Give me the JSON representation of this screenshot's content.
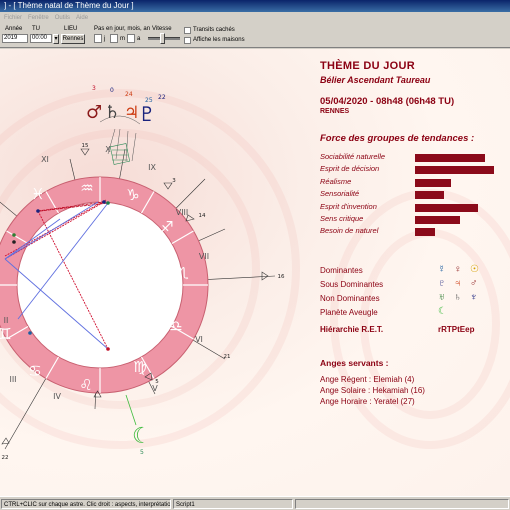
{
  "window": {
    "title": "] - [ Thème natal de Thème du Jour ]"
  },
  "menu": [
    "Fichier",
    "Fenêtre",
    "Outils",
    "Aide"
  ],
  "toolbar": {
    "year_label": "Année",
    "year_value": "2019",
    "tu_label": "TU",
    "tu_value": "00:00",
    "lieu_label": "LIEU",
    "lieu_button": "Rennes",
    "step_label": "Pas en jour, mois, an",
    "step_j": "j",
    "step_m": "m",
    "step_a": "a",
    "vitesse_label": "Vitesse",
    "transits_label": "Transits cachés",
    "maisons_label": "Affiche les maisons"
  },
  "panel": {
    "title": "THÈME DU JOUR",
    "subtitle": "Bélier Ascendant Taureau",
    "date": "05/04/2020 - 08h48 (06h48 TU)",
    "place": "RENNES",
    "force_title": "Force des groupes de tendances :",
    "trends": [
      {
        "label": "Sociabilité naturelle",
        "value": 0.78
      },
      {
        "label": "Esprit de décision",
        "value": 0.88
      },
      {
        "label": "Réalisme",
        "value": 0.4
      },
      {
        "label": "Sensorialité",
        "value": 0.32
      },
      {
        "label": "Esprit d'invention",
        "value": 0.7
      },
      {
        "label": "Sens critique",
        "value": 0.5
      },
      {
        "label": "Besoin de naturel",
        "value": 0.22
      }
    ],
    "dominantes_label": "Dominantes",
    "sous_dominantes_label": "Sous Dominantes",
    "non_dominantes_label": "Non Dominantes",
    "planete_aveugle_label": "Planète Aveugle",
    "ret_label": "Hiérarchie R.E.T.",
    "ret_value": "rRTPtEep",
    "anges_title": "Anges servants :",
    "anges": [
      "Ange Régent : Elemiah (4)",
      "Ange Solaire : Hekamiah (16)",
      "Ange Horaire : Yeratel (27)"
    ]
  },
  "chart": {
    "houses": [
      "XI",
      "X",
      "IX",
      "VIII",
      "VII",
      "VI",
      "V",
      "IV",
      "III",
      "II"
    ],
    "cusp_degrees": [
      "15",
      "3",
      "14",
      "16",
      "21",
      "5",
      "22"
    ],
    "planets_top": [
      "3",
      "0",
      "24",
      "25",
      "22"
    ],
    "moon_degree": "5"
  },
  "status": {
    "hint": "CTRL+CLIC sur chaque astre. Clic droit : aspects, interprétations...",
    "mode": "Script1"
  },
  "colors": {
    "accent": "#8b0012",
    "wheel_pink": "#ec8fa0",
    "bar": "#8b0a1a"
  }
}
